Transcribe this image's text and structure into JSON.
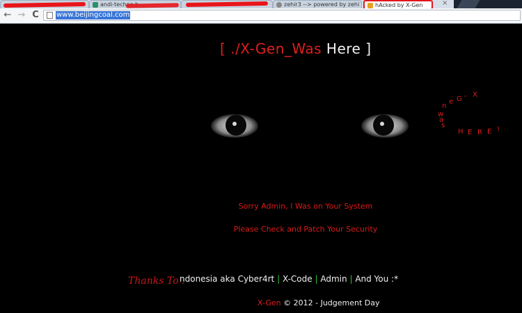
{
  "browser": {
    "tabs": [
      {
        "label": "andi-techno.b...",
        "favicon_color": "#2a8f6a"
      },
      {
        "label": "zehir3 --> powered by zehi",
        "favicon_color": "#888888"
      },
      {
        "label": "hAcked by X-Gen",
        "favicon_color": "#e8a21f"
      }
    ],
    "tab_close": "×",
    "back_icon": "arrow-left",
    "forward_icon": "arrow-right",
    "reload_icon": "reload",
    "back_glyph": "←",
    "forward_glyph": "→",
    "reload_glyph": "C",
    "url": "www.beijingcoal.com"
  },
  "page": {
    "headline_open": "[ ./X-Gen_Was",
    "headline_here": "Here ]",
    "spiral_letters": [
      "X",
      "-",
      "G",
      "e",
      "n",
      "w",
      "a",
      "s",
      "H",
      "E",
      "R",
      "E",
      "!"
    ],
    "message_sorry": "Sorry Admin, I Was on Your System",
    "message_check": "Please Check and Patch Your Security",
    "thanks_label": "Thanks To :",
    "credits": [
      "ndonesia aka Cyber4rt",
      "X-Code",
      "Admin",
      "And You :*"
    ],
    "credit_separator": "|",
    "footer_brand": "X-Gen",
    "footer_text": "© 2012 - Judgement Day"
  },
  "colors": {
    "accent_red": "#e01d1d",
    "separator_green": "#2fc42f",
    "background": "#000000",
    "url_highlight": "#3875d7"
  }
}
